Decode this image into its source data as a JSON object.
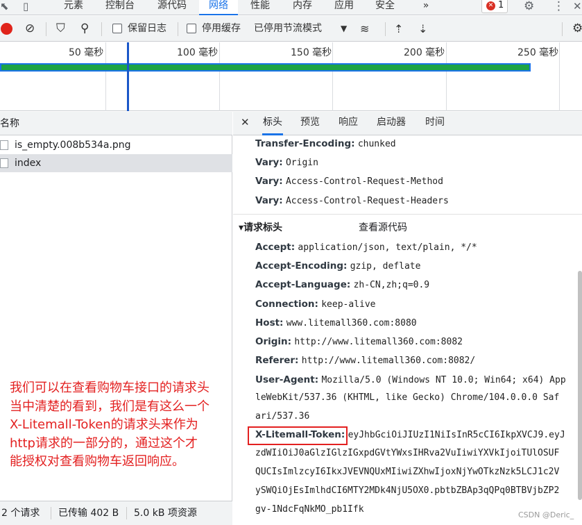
{
  "tabs": [
    "元素",
    "控制台",
    "源代码",
    "网络",
    "性能",
    "内存",
    "应用",
    "安全"
  ],
  "active_tab": "网络",
  "more": "»",
  "error_count": "1",
  "toolbar": {
    "preserve_log": "保留日志",
    "disable_cache": "停用缓存",
    "throttle": "已停用节流模式"
  },
  "timeline": {
    "ticks": [
      "50 毫秒",
      "100 毫秒",
      "150 毫秒",
      "200 毫秒",
      "250 毫秒"
    ]
  },
  "list": {
    "header": "名称",
    "rows": [
      "is_empty.008b534a.png",
      "index"
    ]
  },
  "status": {
    "requests": "2 个请求",
    "transferred": "已传输 402 B",
    "resources": "5.0 kB 项资源"
  },
  "details": {
    "tabs": [
      "标头",
      "预览",
      "响应",
      "启动器",
      "时间"
    ],
    "response_headers": [
      {
        "k": "Transfer-Encoding:",
        "v": "chunked"
      },
      {
        "k": "Vary:",
        "v": "Origin"
      },
      {
        "k": "Vary:",
        "v": "Access-Control-Request-Method"
      },
      {
        "k": "Vary:",
        "v": "Access-Control-Request-Headers"
      }
    ],
    "section_title": "请求标头",
    "view_source": "查看源代码",
    "request_headers": [
      {
        "k": "Accept:",
        "v": "application/json, text/plain, */*"
      },
      {
        "k": "Accept-Encoding:",
        "v": "gzip, deflate"
      },
      {
        "k": "Accept-Language:",
        "v": "zh-CN,zh;q=0.9"
      },
      {
        "k": "Connection:",
        "v": "keep-alive"
      },
      {
        "k": "Host:",
        "v": "www.litemall360.com:8080"
      },
      {
        "k": "Origin:",
        "v": "http://www.litemall360.com:8082"
      },
      {
        "k": "Referer:",
        "v": "http://www.litemall360.com:8082/"
      }
    ],
    "user_agent": {
      "k": "User-Agent:",
      "lines": [
        "Mozilla/5.0 (Windows NT 10.0; Win64; x64) App",
        "leWebKit/537.36 (KHTML, like Gecko) Chrome/104.0.0.0 Saf",
        "ari/537.36"
      ]
    },
    "token": {
      "k": "X-Litemall-Token:",
      "lines": [
        "eyJhbGciOiJIUzI1NiIsInR5cCI6IkpXVCJ9.eyJ",
        "zdWIiOiJ0aGlzIGlzIGxpdGVtYWxsIHRva2VuIiwiYXVkIjoiTUlOSUF",
        "QUCIsImlzcyI6IkxJVEVNQUxMIiwiZXhwIjoxNjYwOTkzNzk5LCJ1c2V",
        "ySWQiOjEsImlhdCI6MTY2MDk4NjU5OX0.pbtbZBAp3qQPq0BTBVjbZP2",
        "gv-1NdcFqNkMO_pb1Ifk"
      ]
    }
  },
  "annotation": [
    "我们可以在查看购物车接口的请求头",
    "当中清楚的看到，我们是有这么一个",
    "X-Litemall-Token的请求头来作为",
    "http请求的一部分的，通过这个才",
    "能授权对查看购物车返回响应。"
  ],
  "watermark": "CSDN @Deric_"
}
